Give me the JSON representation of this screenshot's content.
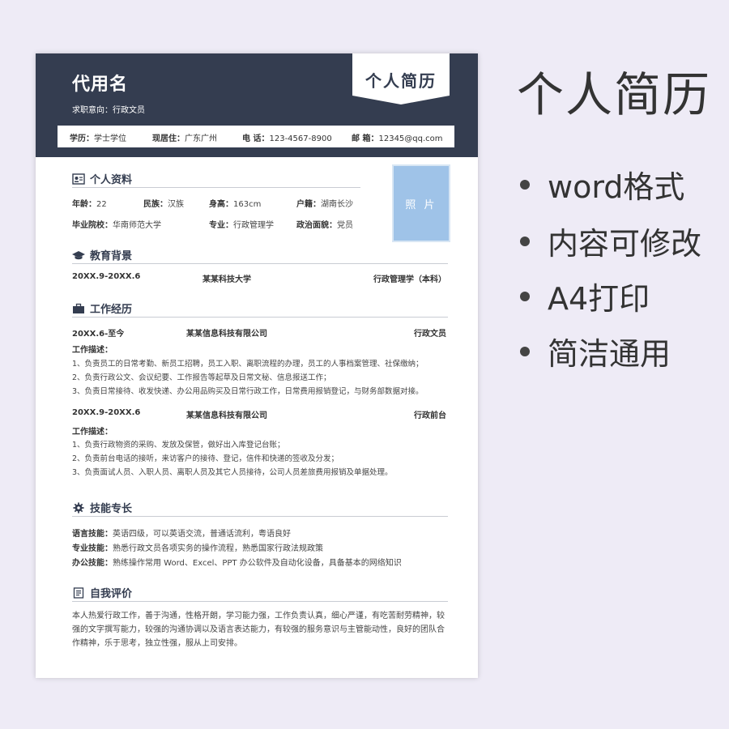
{
  "resume": {
    "name": "代用名",
    "intent": "求职意向：行政文员",
    "banner": "个人简历",
    "info": [
      {
        "label": "学历：",
        "value": "学士学位"
      },
      {
        "label": "现居住：",
        "value": "广东广州"
      },
      {
        "label": "电 话：",
        "value": "123-4567-8900"
      },
      {
        "label": "邮 箱：",
        "value": "12345@qq.com"
      }
    ],
    "photo_label": "照 片",
    "sections": {
      "personal": "个人资料",
      "education": "教育背景",
      "work": "工作经历",
      "skills": "技能专长",
      "self": "自我评价"
    },
    "personal": [
      {
        "label": "年龄：",
        "value": "22"
      },
      {
        "label": "民族：",
        "value": "汉族"
      },
      {
        "label": "身高：",
        "value": "163cm"
      },
      {
        "label": "户籍：",
        "value": "湖南长沙"
      },
      {
        "label": "毕业院校：",
        "value": "华南师范大学"
      },
      {
        "label": "专业：",
        "value": "行政管理学"
      },
      {
        "label": "政治面貌：",
        "value": "党员"
      }
    ],
    "education": {
      "date": "20XX.9-20XX.6",
      "school": "某某科技大学",
      "major": "行政管理学（本科）"
    },
    "work": [
      {
        "date": "20XX.6-至今",
        "company": "某某信息科技有限公司",
        "role": "行政文员",
        "desc_title": "工作描述：",
        "lines": [
          "1、负责员工的日常考勤、新员工招聘，员工入职、离职流程的办理，员工的人事档案管理、社保缴纳；",
          "2、负责行政公文、会议纪要、工作报告等起草及日常文秘、信息报送工作；",
          "3、负责日常接待、收发快递、办公用品购买及日常行政工作，日常费用报销登记，与财务部数据对接。"
        ]
      },
      {
        "date": "20XX.9-20XX.6",
        "company": "某某信息科技有限公司",
        "role": "行政前台",
        "desc_title": "工作描述：",
        "lines": [
          "1、负责行政物资的采购、发放及保管，做好出入库登记台账；",
          "2、负责前台电话的接听，来访客户的接待、登记，信件和快递的签收及分发；",
          "3、负责面试人员、入职人员、离职人员及其它人员接待，公司人员差旅费用报销及单据处理。"
        ]
      }
    ],
    "skills": [
      {
        "label": "语言技能：",
        "value": "英语四级，可以英语交流，普通话流利，粤语良好"
      },
      {
        "label": "专业技能：",
        "value": "熟悉行政文员各项实务的操作流程，熟悉国家行政法规政策"
      },
      {
        "label": "办公技能：",
        "value": "熟练操作常用 Word、Excel、PPT 办公软件及自动化设备，具备基本的网络知识"
      }
    ],
    "self_eval": "本人热爱行政工作，善于沟通，性格开朗，学习能力强，工作负责认真，细心严谨，有吃苦耐劳精神，较强的文字撰写能力，较强的沟通协调以及语言表达能力，有较强的服务意识与主管能动性，良好的团队合作精神，乐于思考，独立性强，服从上司安排。"
  },
  "promo": {
    "title": "个人简历",
    "bullets": [
      "word格式",
      "内容可修改",
      "A4打印",
      "简洁通用"
    ]
  },
  "colors": {
    "header": "#343d50",
    "photo": "#9fc3e8",
    "background": "#eeebf6"
  },
  "icons": {
    "personal": "id-card-icon",
    "education": "graduation-cap-icon",
    "work": "briefcase-icon",
    "skills": "gear-icon",
    "self": "notebook-icon"
  }
}
